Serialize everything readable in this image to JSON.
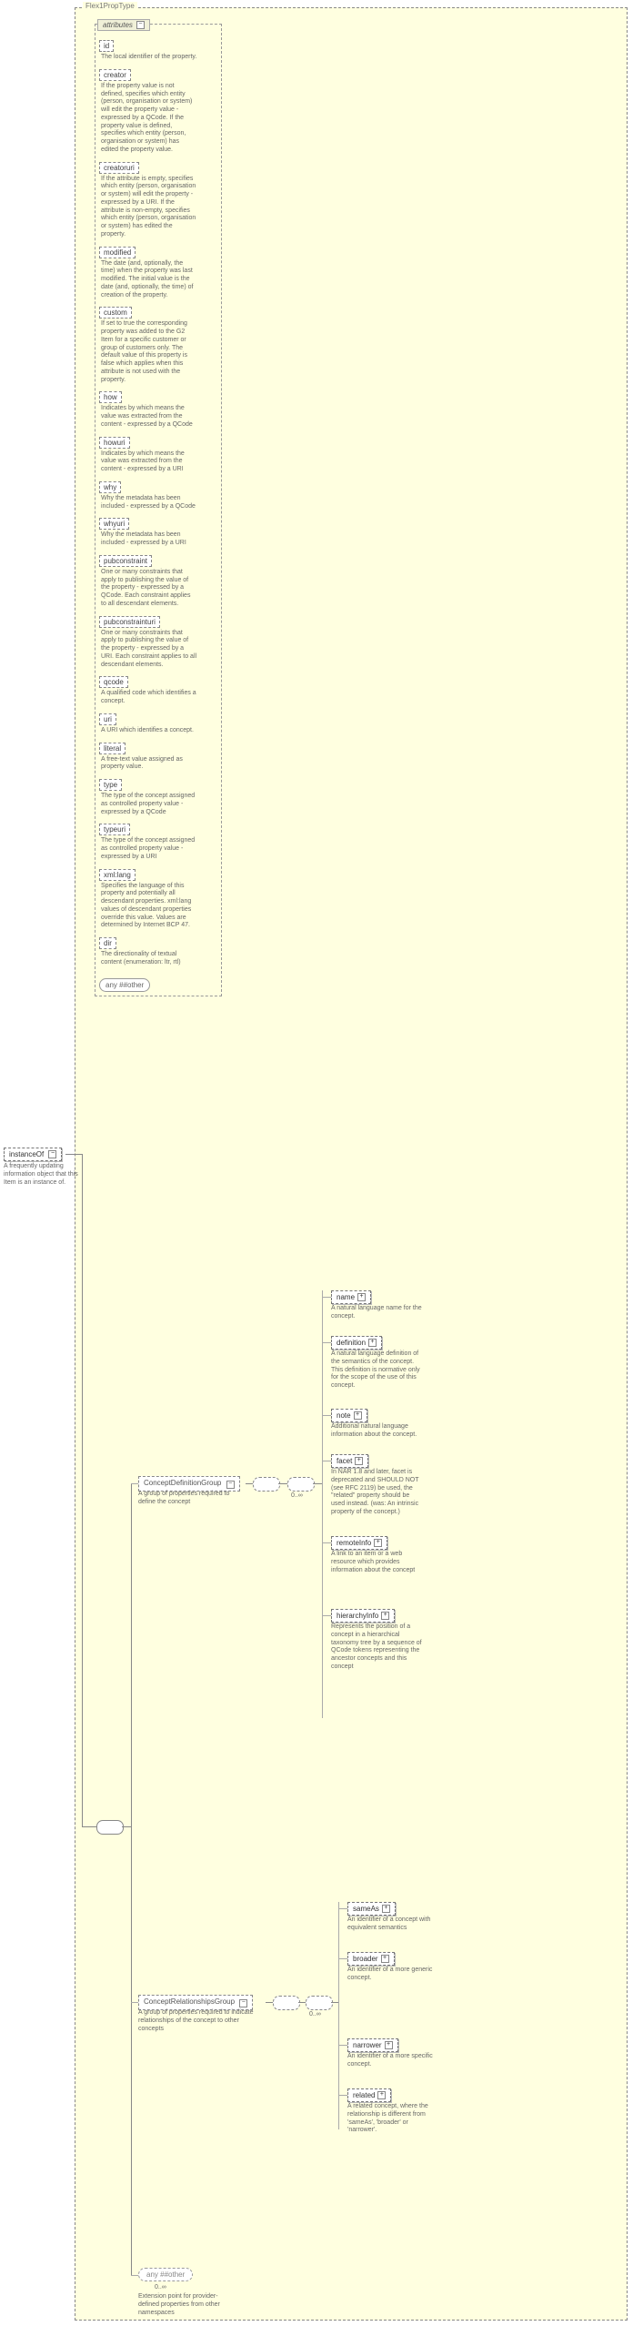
{
  "typeLabel": "Flex1PropType",
  "root": {
    "label": "instanceOf",
    "desc": "A frequently updating information object that this Item is an instance of."
  },
  "attributesHeader": "attributes",
  "attrs": [
    {
      "name": "id",
      "desc": "The local identifier of the property."
    },
    {
      "name": "creator",
      "desc": "If the property value is not defined, specifies which entity (person, organisation or system) will edit the property value - expressed by a QCode. If the property value is defined, specifies which entity (person, organisation or system) has edited the property value."
    },
    {
      "name": "creatoruri",
      "desc": "If the attribute is empty, specifies which entity (person, organisation or system) will edit the property - expressed by a URI. If the attribute is non-empty, specifies which entity (person, organisation or system) has edited the property."
    },
    {
      "name": "modified",
      "desc": "The date (and, optionally, the time) when the property was last modified. The initial value is the date (and, optionally, the time) of creation of the property."
    },
    {
      "name": "custom",
      "desc": "If set to true the corresponding property was added to the G2 Item for a specific customer or group of customers only. The default value of this property is false which applies when this attribute is not used with the property."
    },
    {
      "name": "how",
      "desc": "Indicates by which means the value was extracted from the content - expressed by a QCode"
    },
    {
      "name": "howuri",
      "desc": "Indicates by which means the value was extracted from the content - expressed by a URI"
    },
    {
      "name": "why",
      "desc": "Why the metadata has been included - expressed by a QCode"
    },
    {
      "name": "whyuri",
      "desc": "Why the metadata has been included - expressed by a URI"
    },
    {
      "name": "pubconstraint",
      "desc": "One or many constraints that apply to publishing the value of the property - expressed by a QCode. Each constraint applies to all descendant elements."
    },
    {
      "name": "pubconstrainturi",
      "desc": "One or many constraints that apply to publishing the value of the property - expressed by a URI. Each constraint applies to all descendant elements."
    },
    {
      "name": "qcode",
      "desc": "A qualified code which identifies a concept."
    },
    {
      "name": "uri",
      "desc": "A URI which identifies a concept."
    },
    {
      "name": "literal",
      "desc": "A free-text value assigned as property value."
    },
    {
      "name": "type",
      "desc": "The type of the concept assigned as controlled property value - expressed by a QCode"
    },
    {
      "name": "typeuri",
      "desc": "The type of the concept assigned as controlled property value - expressed by a URI"
    },
    {
      "name": "xml:lang",
      "desc": "Specifies the language of this property and potentially all descendant properties. xml:lang values of descendant properties override this value. Values are determined by Internet BCP 47."
    },
    {
      "name": "dir",
      "desc": "The directionality of textual content (enumeration: ltr, rtl)"
    }
  ],
  "anyOther": "any ##other",
  "groups": {
    "def": {
      "label": "ConceptDefinitionGroup",
      "desc": "A group of properties required to define the concept"
    },
    "rel": {
      "label": "ConceptRelationshipsGroup",
      "desc": "A group of properties required to indicate relationships of the concept to other concepts"
    }
  },
  "defChildren": [
    {
      "name": "name",
      "desc": "A natural language name for the concept."
    },
    {
      "name": "definition",
      "desc": "A natural language definition of the semantics of the concept. This definition is normative only for the scope of the use of this concept."
    },
    {
      "name": "note",
      "desc": "Additional natural language information about the concept."
    },
    {
      "name": "facet",
      "desc": "In NAR 1.8 and later, facet is deprecated and SHOULD NOT (see RFC 2119) be used, the \"related\" property should be used instead. (was: An intrinsic property of the concept.)"
    },
    {
      "name": "remoteInfo",
      "desc": "A link to an item or a web resource which provides information about the concept"
    },
    {
      "name": "hierarchyInfo",
      "desc": "Represents the position of a concept in a hierarchical taxonomy tree by a sequence of QCode tokens representing the ancestor concepts and this concept"
    }
  ],
  "relChildren": [
    {
      "name": "sameAs",
      "desc": "An identifier of a concept with equivalent semantics"
    },
    {
      "name": "broader",
      "desc": "An identifier of a more generic concept."
    },
    {
      "name": "narrower",
      "desc": "An identifier of a more specific concept."
    },
    {
      "name": "related",
      "desc": "A related concept, where the relationship is different from 'sameAs', 'broader' or 'narrower'."
    }
  ],
  "ext": {
    "label": "any ##other",
    "desc": "Extension point for provider-defined properties from other namespaces",
    "card": "0..∞"
  },
  "card0inf": "0..∞"
}
